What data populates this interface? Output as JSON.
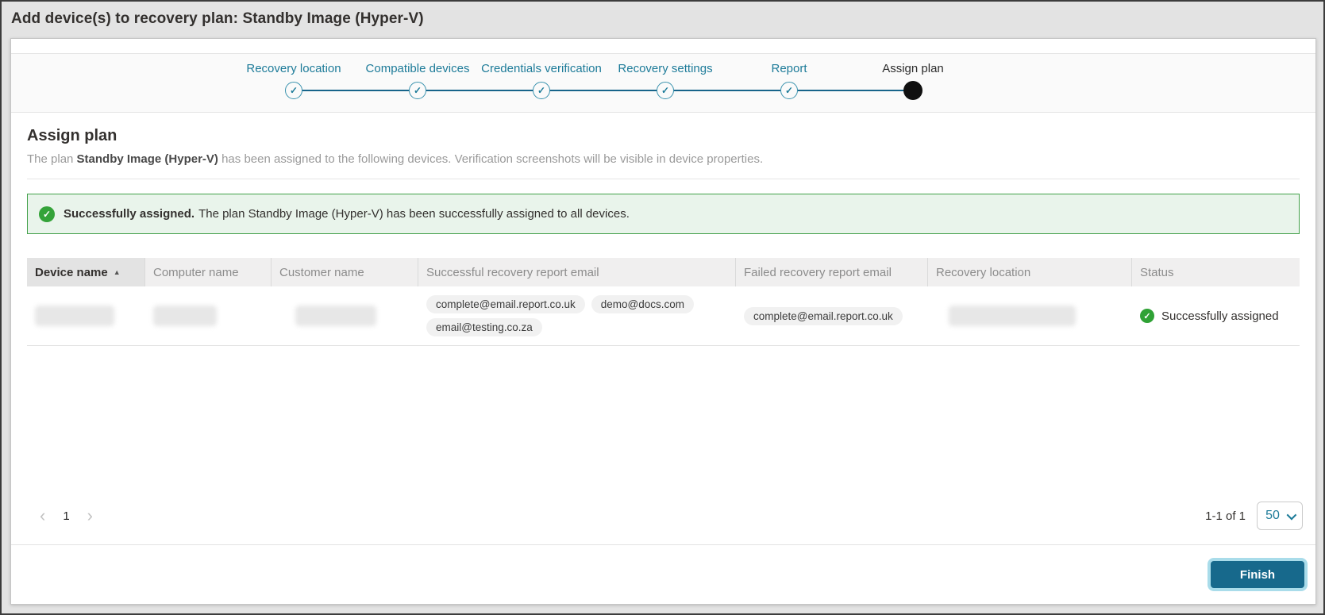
{
  "window": {
    "title": "Add device(s) to recovery plan: Standby Image (Hyper-V)"
  },
  "stepper": {
    "steps": [
      {
        "label": "Recovery location",
        "state": "complete"
      },
      {
        "label": "Compatible devices",
        "state": "complete"
      },
      {
        "label": "Credentials verification",
        "state": "complete"
      },
      {
        "label": "Recovery settings",
        "state": "complete"
      },
      {
        "label": "Report",
        "state": "complete"
      },
      {
        "label": "Assign plan",
        "state": "current"
      }
    ],
    "check_glyph": "✓"
  },
  "section": {
    "title": "Assign plan",
    "description_prefix": "The plan ",
    "description_plan": "Standby Image (Hyper-V)",
    "description_suffix": " has been assigned to the following devices. Verification screenshots will be visible in device properties."
  },
  "alert": {
    "icon": "check-circle",
    "check_glyph": "✓",
    "title": "Successfully assigned.",
    "message": "The plan Standby Image (Hyper-V) has been successfully assigned to all devices."
  },
  "table": {
    "columns": [
      "Device name",
      "Computer name",
      "Customer name",
      "Successful recovery report email",
      "Failed recovery report email",
      "Recovery location",
      "Status"
    ],
    "sort": {
      "column": "Device name",
      "direction": "asc",
      "glyph": "▲"
    },
    "rows": [
      {
        "device_name": "",
        "computer_name": "",
        "customer_name": "",
        "successful_recovery_report_emails": [
          "complete@email.report.co.uk",
          "demo@docs.com",
          "email@testing.co.za"
        ],
        "failed_recovery_report_emails": [
          "complete@email.report.co.uk"
        ],
        "recovery_location": "",
        "status": "Successfully assigned",
        "status_check_glyph": "✓"
      }
    ]
  },
  "pagination": {
    "prev_glyph": "‹",
    "page": "1",
    "next_glyph": "›",
    "range": "1-1 of 1",
    "page_size": "50"
  },
  "footer": {
    "finish_label": "Finish"
  },
  "colors": {
    "accent": "#1d7b99",
    "stepper_line": "#17648a",
    "success_green": "#34a339",
    "alert_bg": "#e9f4eb",
    "alert_border": "#42a049",
    "button_bg": "#17698c",
    "button_glow": "#a9dcea",
    "titlebar_bg": "#e3e3e3",
    "header_bg": "#f0efef",
    "sorted_header_bg": "#e3e3e3"
  }
}
